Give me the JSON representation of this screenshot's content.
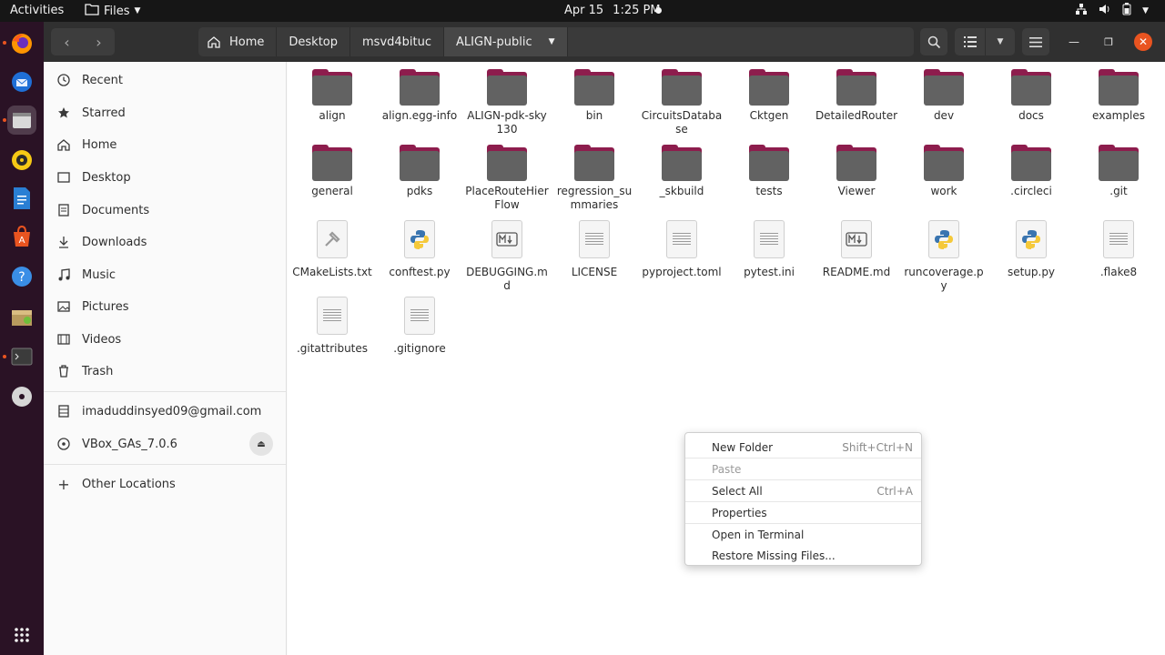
{
  "topbar": {
    "activities": "Activities",
    "app_name": "Files",
    "date": "Apr 15",
    "time": "1:25 PM"
  },
  "dock": {
    "items": [
      {
        "name": "firefox",
        "icon": "firefox-icon"
      },
      {
        "name": "thunderbird",
        "icon": "thunderbird-icon"
      },
      {
        "name": "files",
        "icon": "files-icon"
      },
      {
        "name": "rhythmbox",
        "icon": "rhythmbox-icon"
      },
      {
        "name": "writer",
        "icon": "libreoffice-writer-icon"
      },
      {
        "name": "software",
        "icon": "ubuntu-software-icon"
      },
      {
        "name": "help",
        "icon": "help-icon"
      },
      {
        "name": "guest-additions",
        "icon": "vbox-additions-icon"
      },
      {
        "name": "terminal",
        "icon": "terminal-icon"
      },
      {
        "name": "disc",
        "icon": "optical-disc-icon"
      },
      {
        "name": "show-apps",
        "icon": "app-grid-icon"
      }
    ]
  },
  "pathbar": {
    "crumbs": [
      "Home",
      "Desktop",
      "msvd4bituc",
      "ALIGN-public"
    ]
  },
  "sidebar": {
    "items": [
      {
        "label": "Recent",
        "icon": "clock-icon"
      },
      {
        "label": "Starred",
        "icon": "star-icon"
      },
      {
        "label": "Home",
        "icon": "home-icon"
      },
      {
        "label": "Desktop",
        "icon": "desktop-icon"
      },
      {
        "label": "Documents",
        "icon": "document-icon"
      },
      {
        "label": "Downloads",
        "icon": "download-icon"
      },
      {
        "label": "Music",
        "icon": "music-icon"
      },
      {
        "label": "Pictures",
        "icon": "picture-icon"
      },
      {
        "label": "Videos",
        "icon": "video-icon"
      },
      {
        "label": "Trash",
        "icon": "trash-icon"
      }
    ],
    "accounts": [
      {
        "label": "imaduddinsyed09@gmail.com",
        "icon": "online-account-icon"
      },
      {
        "label": "VBox_GAs_7.0.6",
        "icon": "disc-icon"
      }
    ],
    "other_locations": "Other Locations"
  },
  "files": [
    {
      "name": "align",
      "type": "folder"
    },
    {
      "name": "align.egg-info",
      "type": "folder"
    },
    {
      "name": "ALIGN-pdk-sky130",
      "type": "folder"
    },
    {
      "name": "bin",
      "type": "folder"
    },
    {
      "name": "CircuitsDatabase",
      "type": "folder"
    },
    {
      "name": "Cktgen",
      "type": "folder"
    },
    {
      "name": "DetailedRouter",
      "type": "folder"
    },
    {
      "name": "dev",
      "type": "folder"
    },
    {
      "name": "docs",
      "type": "folder"
    },
    {
      "name": "examples",
      "type": "folder"
    },
    {
      "name": "general",
      "type": "folder"
    },
    {
      "name": "pdks",
      "type": "folder"
    },
    {
      "name": "PlaceRouteHierFlow",
      "type": "folder"
    },
    {
      "name": "regression_summaries",
      "type": "folder"
    },
    {
      "name": "_skbuild",
      "type": "folder"
    },
    {
      "name": "tests",
      "type": "folder"
    },
    {
      "name": "Viewer",
      "type": "folder"
    },
    {
      "name": "work",
      "type": "folder"
    },
    {
      "name": ".circleci",
      "type": "folder"
    },
    {
      "name": ".git",
      "type": "folder"
    },
    {
      "name": "CMakeLists.txt",
      "type": "cmake"
    },
    {
      "name": "conftest.py",
      "type": "python"
    },
    {
      "name": "DEBUGGING.md",
      "type": "markdown"
    },
    {
      "name": "LICENSE",
      "type": "text"
    },
    {
      "name": "pyproject.toml",
      "type": "text"
    },
    {
      "name": "pytest.ini",
      "type": "text"
    },
    {
      "name": "README.md",
      "type": "markdown"
    },
    {
      "name": "runcoverage.py",
      "type": "python"
    },
    {
      "name": "setup.py",
      "type": "python"
    },
    {
      "name": ".flake8",
      "type": "text"
    },
    {
      "name": ".gitattributes",
      "type": "text"
    },
    {
      "name": ".gitignore",
      "type": "text"
    }
  ],
  "context_menu": {
    "items": [
      {
        "label": "New Folder",
        "accel": "Shift+Ctrl+N",
        "disabled": false
      },
      {
        "label": "Paste",
        "accel": "",
        "disabled": true
      },
      {
        "label": "Select All",
        "accel": "Ctrl+A",
        "disabled": false
      },
      {
        "label": "Properties",
        "accel": "",
        "disabled": false
      },
      {
        "label": "Open in Terminal",
        "accel": "",
        "disabled": false
      },
      {
        "label": "Restore Missing Files...",
        "accel": "",
        "disabled": false
      }
    ]
  },
  "colors": {
    "folder_tab": "#8d1d4d",
    "folder_body": "#626262",
    "accent": "#e95420",
    "dock_bg": "#2a1225"
  }
}
